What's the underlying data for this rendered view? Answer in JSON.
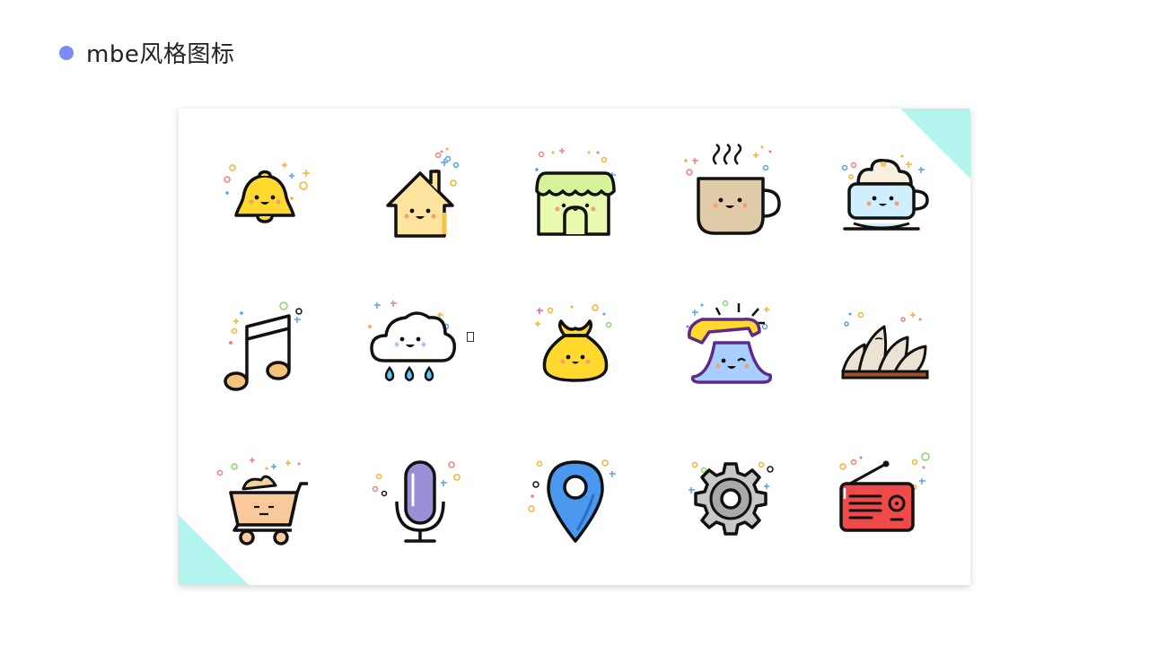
{
  "page": {
    "title": "mbe风格图标",
    "accent_color": "#7b8cf6",
    "corner_color": "#b4f4ee"
  },
  "icons": [
    {
      "name": "bell-icon"
    },
    {
      "name": "house-icon"
    },
    {
      "name": "shop-icon"
    },
    {
      "name": "coffee-cup-icon"
    },
    {
      "name": "cappuccino-cup-icon"
    },
    {
      "name": "music-note-icon"
    },
    {
      "name": "rain-cloud-icon"
    },
    {
      "name": "money-bag-icon"
    },
    {
      "name": "telephone-icon"
    },
    {
      "name": "opera-house-icon"
    },
    {
      "name": "shopping-cart-icon"
    },
    {
      "name": "microphone-icon"
    },
    {
      "name": "location-pin-icon"
    },
    {
      "name": "gear-icon"
    },
    {
      "name": "radio-icon"
    }
  ]
}
